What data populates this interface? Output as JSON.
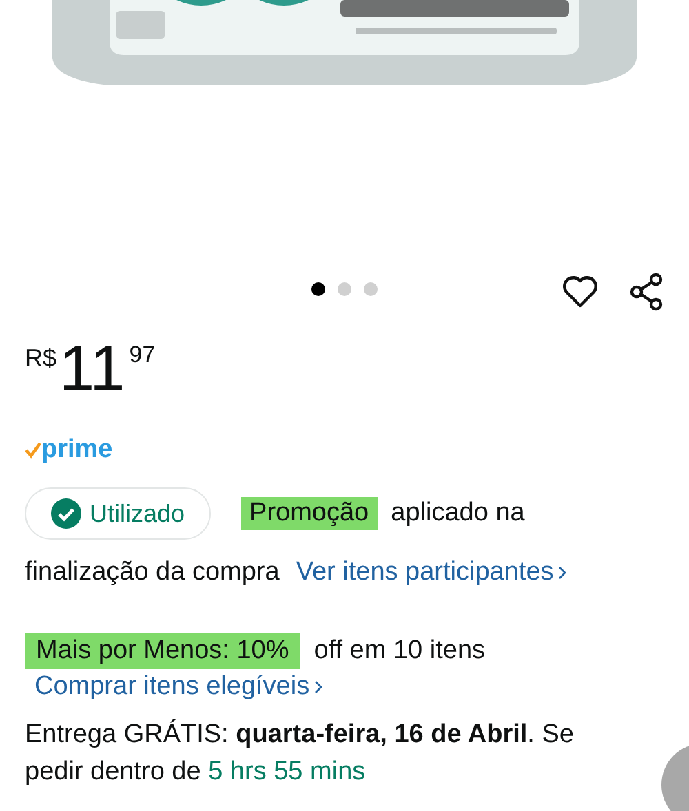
{
  "gallery": {
    "dots": [
      {
        "selected": true
      },
      {
        "selected": false
      },
      {
        "selected": false
      }
    ]
  },
  "price": {
    "currency": "R$",
    "whole": "11",
    "fraction": "97"
  },
  "prime": {
    "label": "prime"
  },
  "coupon": {
    "status": "Utilizado",
    "applied": true,
    "highlight": "Promoção",
    "text_1": "aplicado na",
    "text_2": "finalização da compra",
    "link": "Ver itens participantes"
  },
  "deal": {
    "highlight": "Mais por Menos: 10%",
    "text": "off em 10 itens",
    "link": "Comprar itens elegíveis"
  },
  "delivery": {
    "prefix": "Entrega GRÁTIS: ",
    "date": "quarta-feira, 16 de Abril",
    "suffix": ". Se pedir dentro de ",
    "countdown": "5 hrs 55 mins"
  }
}
